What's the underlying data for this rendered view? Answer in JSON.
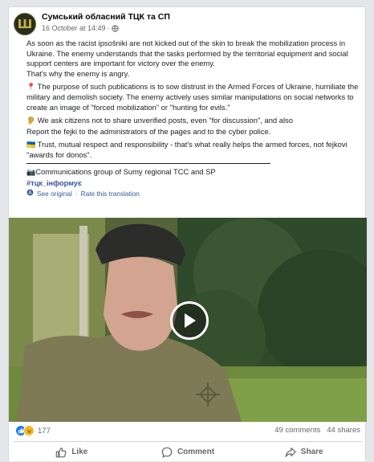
{
  "post": {
    "page_name": "Сумський обласний ТЦК та СП",
    "date": "16 October at 14:49",
    "avatar_icon": "trident-emblem-icon",
    "paragraphs": [
      "As soon as the racist ipsoŝniki are not kicked out of the skin to break the mobilization process in Ukraine. The enemy understands that the tasks performed by the territorial equipment and social support centers are important for victory over the enemy.\nThat's why the enemy is angry.",
      "The purpose of such publications is to sow distrust in the Armed Forces of Ukraine, humiliate the military and demolish society. The enemy actively uses similar manipulations on social networks to create an image of \"forced mobilization\" or \"hunting for evils.\"",
      "We ask citizens not to share unverified posts, even \"for discussion\", and also\nReport the fejki to the administrators of the pages and to the cyber police.",
      "Trust, mutual respect and responsibility - that's what really helps the armed forces, not fejkovi \"awards for donos\"."
    ],
    "paragraph_emojis": [
      "",
      "📍",
      "🦻",
      "🇺🇦"
    ],
    "signature": "Communications group of Sumy regional TCC and SP",
    "signature_emoji": "📷",
    "hashtag": "#тцк_інформує",
    "see_original": "See original",
    "rate_translation": "Rate this translation"
  },
  "stats": {
    "reaction_count": "177",
    "comments": "49 comments",
    "shares": "44 shares"
  },
  "actions": {
    "like": "Like",
    "comment": "Comment",
    "share": "Share"
  },
  "colors": {
    "link": "#385898",
    "muted": "#65676b",
    "like_blue": "#1877f2"
  }
}
